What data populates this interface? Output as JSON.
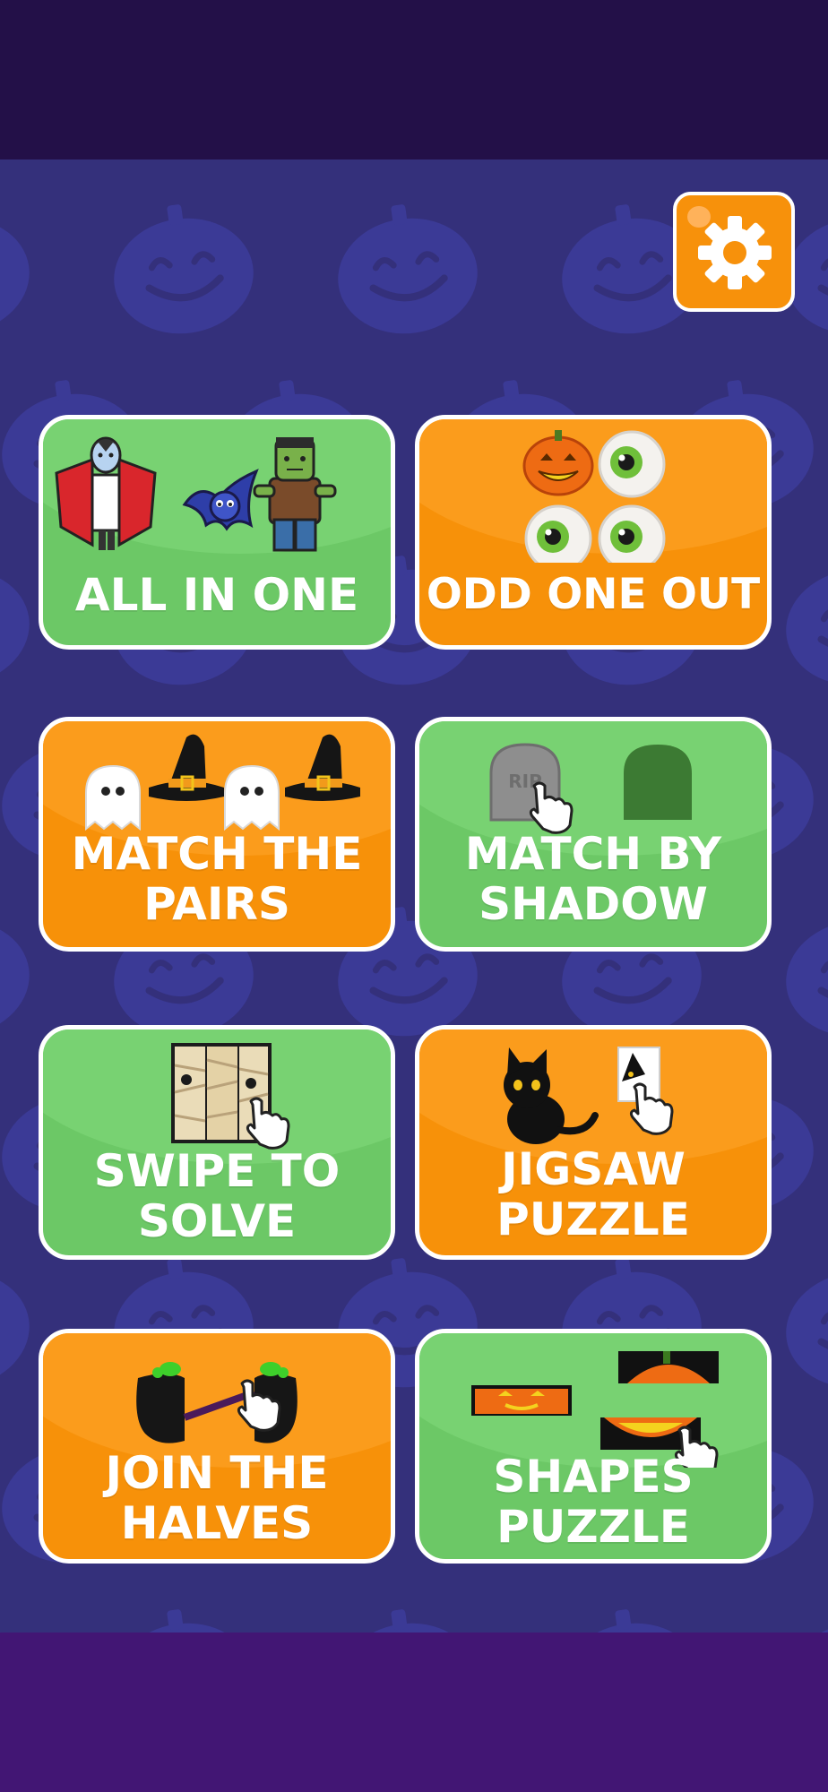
{
  "colors": {
    "top_bar": "#231048",
    "bottom_bar": "#421674",
    "background": "#34307b",
    "card_green": "#6cc866",
    "card_orange": "#f79109",
    "settings_button": "#f7910b"
  },
  "settings": {
    "icon": "gear-icon"
  },
  "menu": {
    "cards": [
      {
        "id": "all-in-one",
        "lines": [
          "ALL IN ONE"
        ],
        "color": "green",
        "icons": [
          "vampire",
          "bat",
          "frankenstein"
        ]
      },
      {
        "id": "odd-one-out",
        "lines": [
          "ODD ONE OUT"
        ],
        "color": "orange",
        "icons": [
          "pumpkin",
          "eyeball",
          "eyeball",
          "eyeball"
        ]
      },
      {
        "id": "match-the-pairs",
        "lines": [
          "MATCH THE",
          "PAIRS"
        ],
        "color": "orange",
        "icons": [
          "ghost",
          "witch-hat",
          "ghost",
          "witch-hat"
        ]
      },
      {
        "id": "match-by-shadow",
        "lines": [
          "MATCH BY",
          "SHADOW"
        ],
        "color": "green",
        "icons": [
          "tombstone",
          "hand-pointer",
          "tombstone-shadow"
        ],
        "tombstone_text": "RIP"
      },
      {
        "id": "swipe-to-solve",
        "lines": [
          "SWIPE TO",
          "SOLVE"
        ],
        "color": "green",
        "icons": [
          "mummy-tiles",
          "hand-pointer"
        ]
      },
      {
        "id": "jigsaw-puzzle",
        "lines": [
          "JIGSAW",
          "PUZZLE"
        ],
        "color": "orange",
        "icons": [
          "black-cat",
          "puzzle-piece",
          "hand-pointer"
        ]
      },
      {
        "id": "join-the-halves",
        "lines": [
          "JOIN THE",
          "HALVES"
        ],
        "color": "orange",
        "icons": [
          "cauldron-halves",
          "hand-pointer"
        ]
      },
      {
        "id": "shapes-puzzle",
        "lines": [
          "SHAPES",
          "PUZZLE"
        ],
        "color": "green",
        "icons": [
          "pumpkin-pieces",
          "hand-pointer"
        ]
      }
    ]
  }
}
